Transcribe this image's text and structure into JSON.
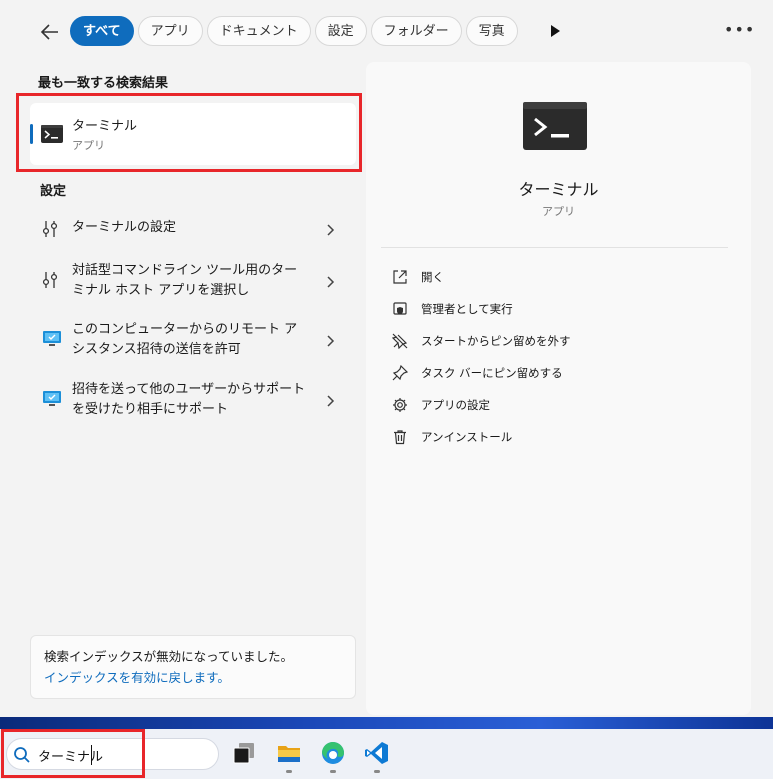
{
  "filters": {
    "chips": [
      "すべて",
      "アプリ",
      "ドキュメント",
      "設定",
      "フォルダー",
      "写真"
    ],
    "active_index": 0
  },
  "best_match": {
    "section_title": "最も一致する検索結果",
    "name": "ターミナル",
    "type": "アプリ"
  },
  "settings": {
    "section_title": "設定",
    "items": [
      {
        "label": "ターミナルの設定",
        "icon": "settings-sliders-icon"
      },
      {
        "label": "対話型コマンドライン ツール用のターミナル ホスト アプリを選択し",
        "icon": "settings-sliders-icon"
      },
      {
        "label": "このコンピューターからのリモート アシスタンス招待の送信を許可",
        "icon": "remote-pc-icon"
      },
      {
        "label": "招待を送って他のユーザーからサポートを受けたり相手にサポート",
        "icon": "remote-pc-icon"
      }
    ]
  },
  "index_notice": {
    "text": "検索インデックスが無効になっていました。",
    "link": "インデックスを有効に戻します。"
  },
  "preview": {
    "title": "ターミナル",
    "subtitle": "アプリ",
    "actions": [
      {
        "label": "開く",
        "icon": "open-external-icon"
      },
      {
        "label": "管理者として実行",
        "icon": "shield-icon"
      },
      {
        "label": "スタートからピン留めを外す",
        "icon": "unpin-icon"
      },
      {
        "label": "タスク バーにピン留めする",
        "icon": "pin-icon"
      },
      {
        "label": "アプリの設定",
        "icon": "gear-icon"
      },
      {
        "label": "アンインストール",
        "icon": "trash-icon"
      }
    ]
  },
  "taskbar": {
    "search_value": "ターミナル",
    "apps": [
      "task-view-icon",
      "file-explorer-icon",
      "edge-icon",
      "vscode-icon"
    ]
  },
  "colors": {
    "accent": "#0f6cbd",
    "highlight_box": "#e8262a"
  }
}
